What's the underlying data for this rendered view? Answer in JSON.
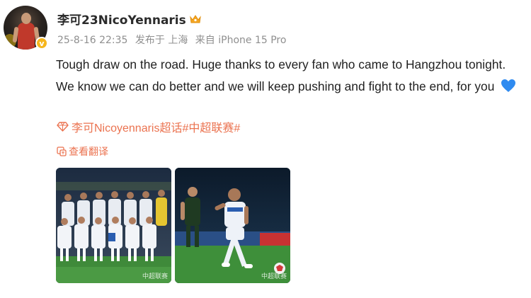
{
  "post": {
    "username": "李可23NicoYennaris",
    "meta": {
      "datetime": "25-8-16 22:35",
      "location": "发布于 上海",
      "device": "来自 iPhone 15 Pro"
    },
    "text": "Tough draw on the road. Huge thanks to every fan who came to Hangzhou tonight. We know we can do better and we will keep pushing and fight to the end, for you",
    "emoji_icon": "blue-heart-icon",
    "topic": "李可Nicoyennaris超话#中超联赛#",
    "translate_label": "查看翻译",
    "images": [
      {
        "name": "team-photo",
        "watermark": "中超联赛"
      },
      {
        "name": "action-photo",
        "watermark": "中超联赛"
      }
    ]
  },
  "colors": {
    "accent": "#eb7350",
    "meta_gray": "#8f8f8f",
    "badge_gold": "#f6b61d",
    "heart_blue": "#2f8bf0"
  }
}
